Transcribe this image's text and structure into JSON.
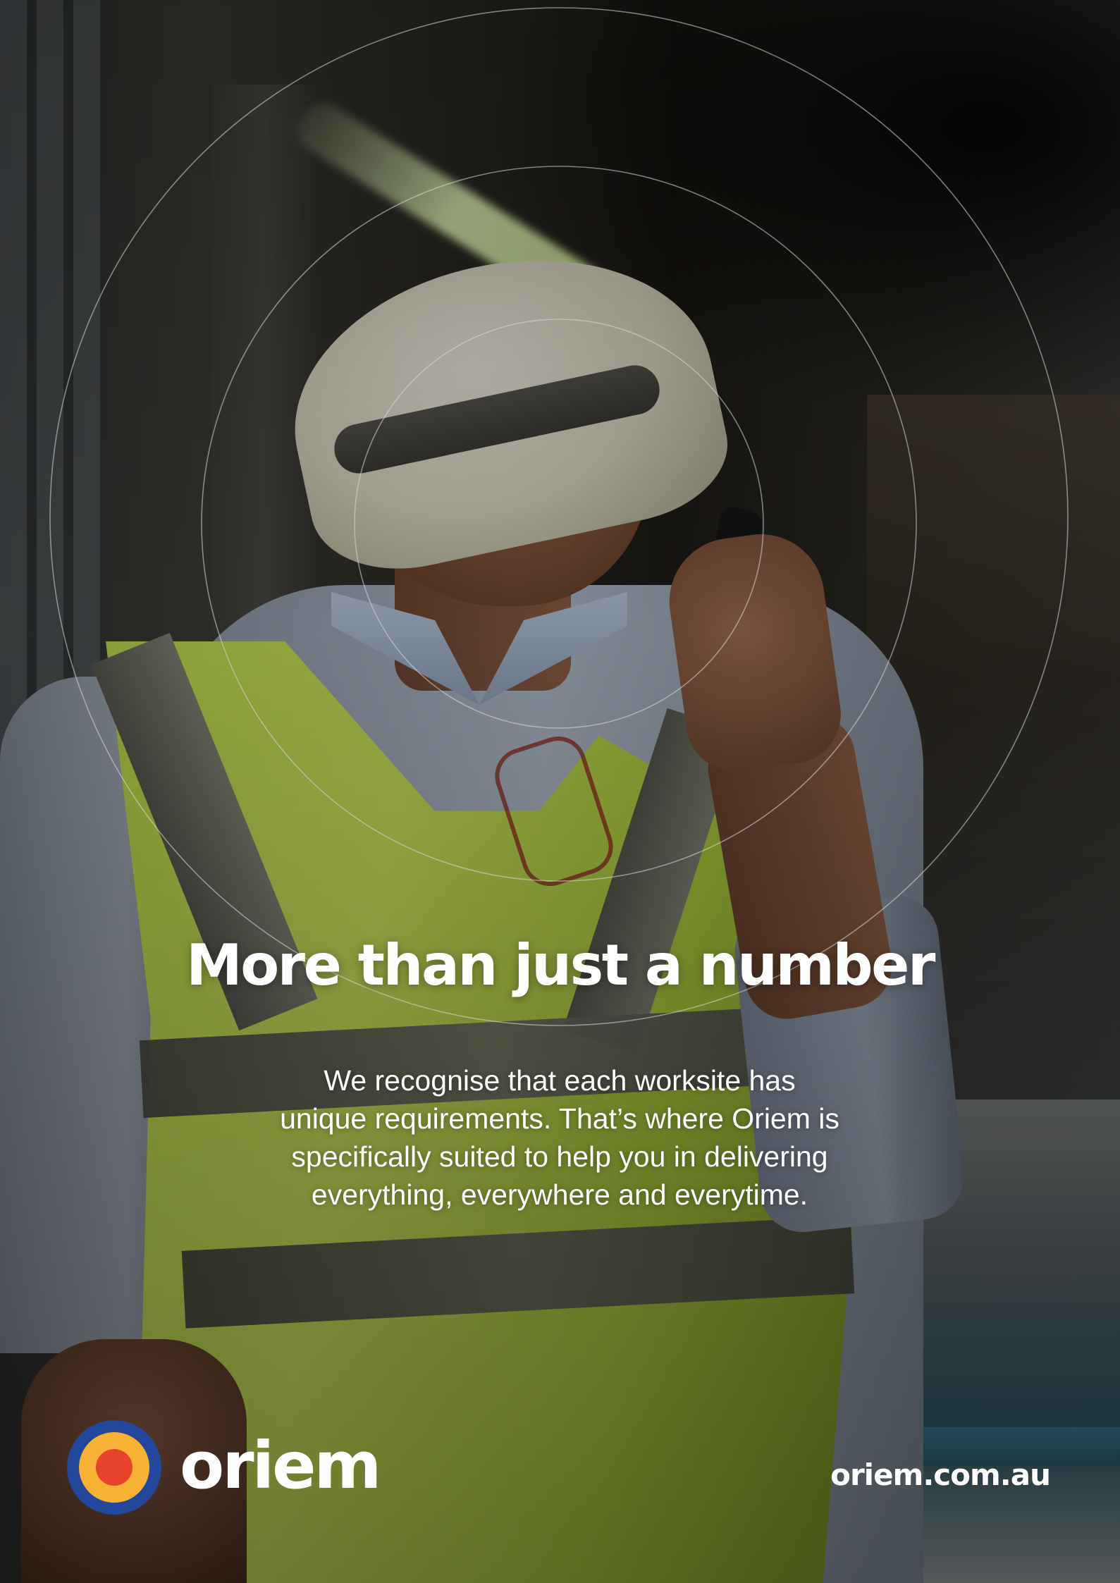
{
  "hero": {
    "headline": "More than just a number",
    "body_lines": [
      "We recognise that each worksite has",
      "unique requirements. That’s where Oriem is",
      "specifically suited to help you in delivering",
      "everything, everywhere and everytime."
    ]
  },
  "brand": {
    "name": "oriem",
    "logo_colors": {
      "outer": "#23479B",
      "middle": "#F7B236",
      "inner": "#E8412C"
    }
  },
  "footer": {
    "url": "oriem.com.au"
  },
  "colors": {
    "text": "#FFFFFF",
    "ring_stroke": "#D8D8D8"
  }
}
